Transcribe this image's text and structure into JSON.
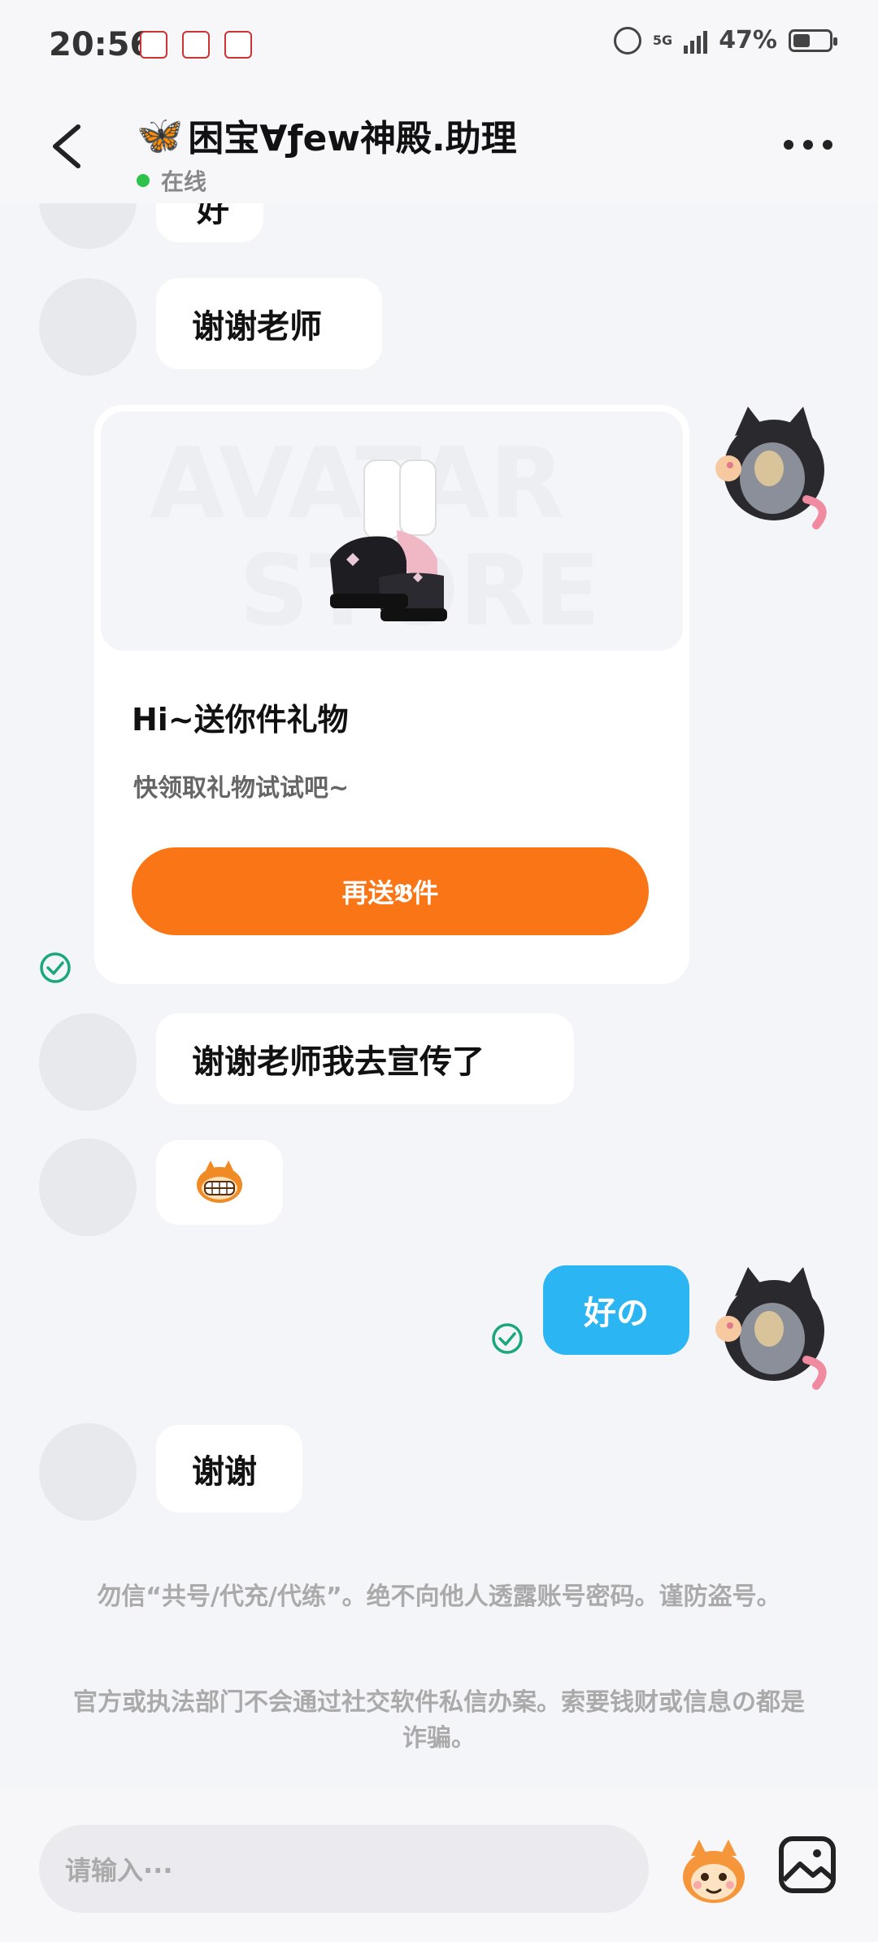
{
  "status_bar": {
    "time": "20:56",
    "network_type": "5G",
    "battery_percent": "47%",
    "battery_level": 0.47
  },
  "header": {
    "back_icon": "chevron-left-icon",
    "title_emoji": "🦋",
    "title": "困宝Ɐƒew神殿.助理",
    "status": "在线",
    "more_icon": "more-dots-icon"
  },
  "messages": {
    "partial_top": "好",
    "thanks_teacher": "谢谢老师",
    "gift_card": {
      "watermark_line1": "AVATAR",
      "watermark_line2": "STORE",
      "title": "Hi~送你件礼物",
      "subtitle": "快领取礼物试试吧~",
      "button_label": "再送𝕭件"
    },
    "promote": "谢谢老师我去宣传了",
    "sticker": "grinning-monkey-sticker",
    "self_reply": "好の",
    "thanks": "谢谢"
  },
  "notices": {
    "line1": "勿信“共号/代充/代练”。绝不向他人透露账号密码。谨防盗号。",
    "line2": "官方或执法部门不会通过社交软件私信办案。索要钱财或信息の都是诈骗。"
  },
  "input": {
    "placeholder": "请输入···",
    "emoji_icon": "monkey-emoji-icon",
    "image_icon": "image-icon"
  },
  "colors": {
    "accent_orange": "#fa7516",
    "self_bubble": "#2bb5f2",
    "online_green": "#2ec24b",
    "check_green": "#1aa77a"
  }
}
